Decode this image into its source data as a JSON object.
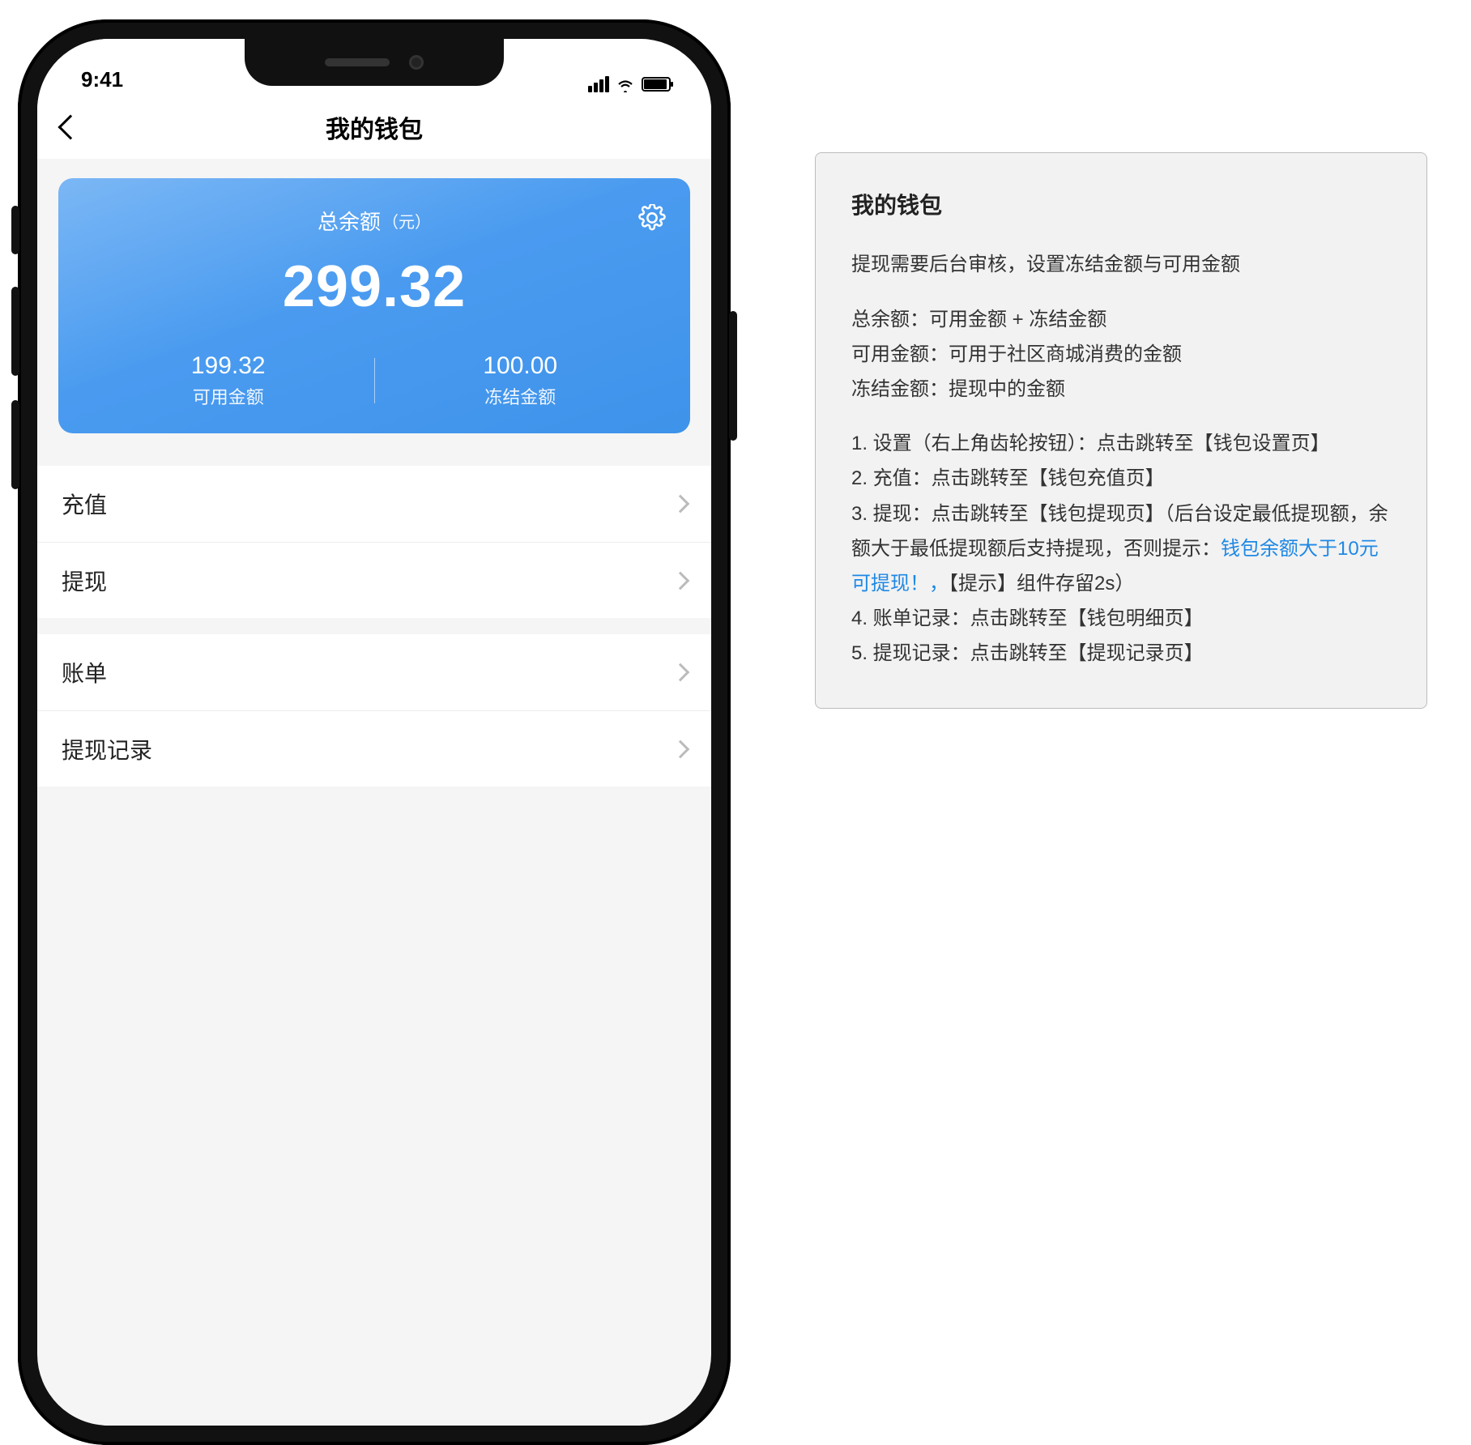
{
  "status": {
    "time": "9:41"
  },
  "nav": {
    "title": "我的钱包"
  },
  "balance": {
    "label": "总余额",
    "unit": "（元）",
    "total": "299.32",
    "available_value": "199.32",
    "available_label": "可用金额",
    "frozen_value": "100.00",
    "frozen_label": "冻结金额"
  },
  "menu": {
    "recharge": "充值",
    "withdraw": "提现",
    "bill": "账单",
    "withdraw_record": "提现记录"
  },
  "anno": {
    "title": "我的钱包",
    "p1": "提现需要后台审核，设置冻结金额与可用金额",
    "d1": "总余额：可用金额 + 冻结金额",
    "d2": "可用金额：可用于社区商城消费的金额",
    "d3": "冻结金额：提现中的金额",
    "n1": "1. 设置（右上角齿轮按钮）：点击跳转至【钱包设置页】",
    "n2": "2. 充值：点击跳转至【钱包充值页】",
    "n3a": "3. 提现：点击跳转至【钱包提现页】（后台设定最低提现额，余额大于最低提现额后支持提现，否则提示：",
    "n3link": "钱包余额大于10元可提现！，",
    "n3b": "【提示】组件存留2s）",
    "n4": "4. 账单记录：点击跳转至【钱包明细页】",
    "n5": "5. 提现记录：点击跳转至【提现记录页】"
  }
}
